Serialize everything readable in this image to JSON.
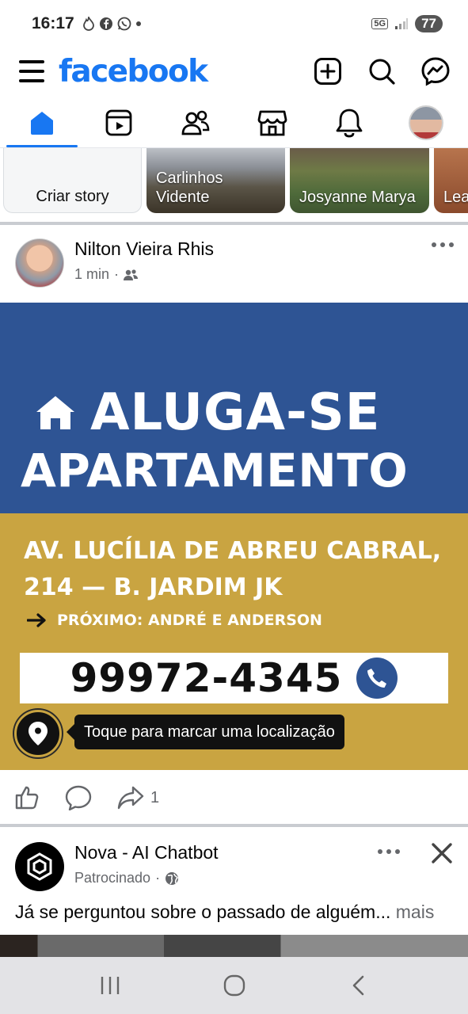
{
  "status_bar": {
    "time": "16:17",
    "battery": "77",
    "network": "5G"
  },
  "header": {
    "logo": "facebook"
  },
  "tabs": [
    "home",
    "video",
    "friends",
    "marketplace",
    "notifications",
    "profile"
  ],
  "stories": {
    "create_label": "Criar story",
    "items": [
      {
        "name": "Carlinhos\nVidente"
      },
      {
        "name": "Josyanne Marya"
      },
      {
        "name": "Lea"
      }
    ]
  },
  "post": {
    "author": "Nilton Vieira Rhis",
    "time": "1 min",
    "separator": "·",
    "image": {
      "headline1": "ALUGA-SE",
      "headline2": "APARTAMENTO",
      "address_line1": "AV. LUCÍLIA DE ABREU CABRAL,",
      "address_line2": "214 — B. JARDIM JK",
      "near": "PRÓXIMO: ANDRÉ E ANDERSON",
      "phone": "99972-4345",
      "colors": {
        "top": "#2e5494",
        "bottom": "#c9a441"
      }
    },
    "location_tip": "Toque para marcar uma localização",
    "share_count": "1"
  },
  "sponsored": {
    "name": "Nova - AI Chatbot",
    "label": "Patrocinado",
    "separator": "·",
    "text": "Já se perguntou sobre o passado de alguém...",
    "more": "mais"
  },
  "colors": {
    "brand": "#1877f2",
    "text": "#050505",
    "muted": "#65676b"
  }
}
